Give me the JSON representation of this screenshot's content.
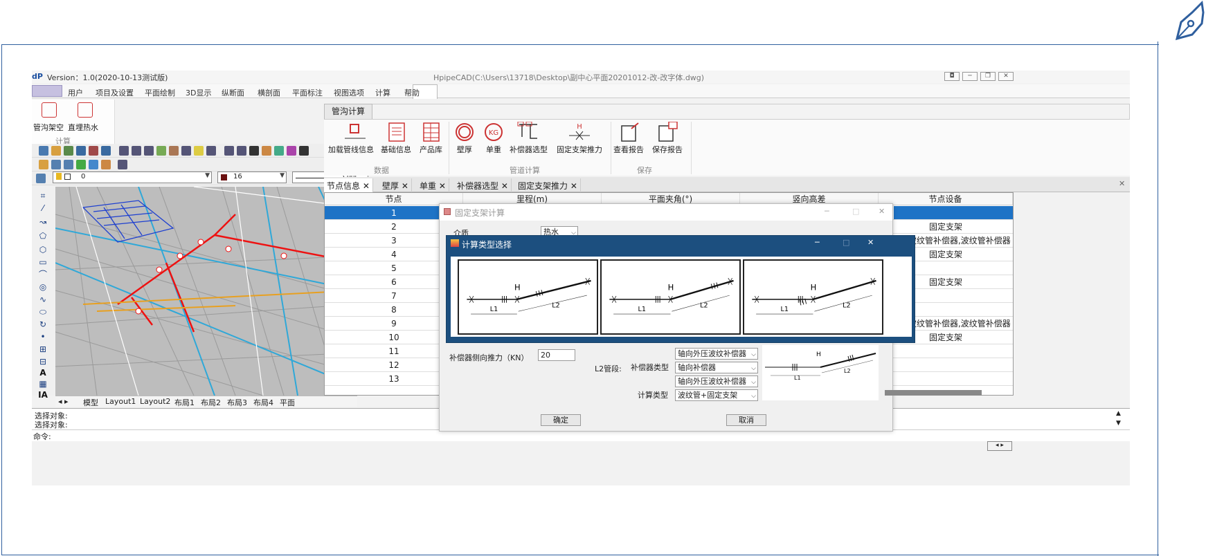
{
  "cad": {
    "version": "Version：1.0(2020-10-13测试版)",
    "title": "HpipeCAD(C:\\Users\\13718\\Desktop\\副中心平面20201012-改-改字体.dwg)",
    "menu": [
      "用户",
      "项目及设置",
      "平面绘制",
      "3D显示",
      "纵断面",
      "横剖面",
      "平面标注",
      "视图选项",
      "计算",
      "帮助"
    ],
    "left_ribbon": {
      "btn1": "管沟架空",
      "btn2": "直埋热水",
      "group": "计算"
    },
    "layer": "0",
    "color_value": "16",
    "linetype": "Cont",
    "layout_tabs": [
      "模型",
      "Layout1",
      "Layout2",
      "布局1",
      "布局2",
      "布局3",
      "布局4",
      "平面"
    ],
    "cmd_lines": [
      "选择对象:",
      "选择对象:",
      "命令:"
    ]
  },
  "ribbon": {
    "tab": "管沟计算",
    "buttons": [
      "加载管线信息",
      "基础信息",
      "产品库",
      "壁厚",
      "单重",
      "补偿器选型",
      "固定支架推力",
      "查看报告",
      "保存报告"
    ],
    "groups": [
      "数据",
      "管道计算",
      "保存"
    ]
  },
  "doc_tabs": [
    "节点信息",
    "壁厚",
    "单重",
    "补偿器选型",
    "固定支架推力"
  ],
  "table": {
    "headers": [
      "节点",
      "里程(m)",
      "平面夹角(°)",
      "竖向高差",
      "节点设备"
    ],
    "rows": [
      {
        "n": "1",
        "dev": ""
      },
      {
        "n": "2",
        "dev": "固定支架"
      },
      {
        "n": "3",
        "dev": "定支架,波纹管补偿器,波纹管补偿器"
      },
      {
        "n": "4",
        "dev": "固定支架"
      },
      {
        "n": "5",
        "dev": ""
      },
      {
        "n": "6",
        "dev": "固定支架"
      },
      {
        "n": "7",
        "dev": ""
      },
      {
        "n": "8",
        "dev": ""
      },
      {
        "n": "9",
        "dev": "定支架,波纹管补偿器,波纹管补偿器"
      },
      {
        "n": "10",
        "dev": "固定支架"
      },
      {
        "n": "11",
        "dev": ""
      },
      {
        "n": "12",
        "dev": ""
      },
      {
        "n": "13",
        "dev": ""
      }
    ]
  },
  "dialog1": {
    "title": "固定支架计算",
    "medium_label": "介质",
    "medium_value": "热水",
    "thrust_label": "补偿器侧向推力（KN）",
    "thrust_value": "20",
    "l2_label": "L2管段:",
    "comp_type_label": "补偿器类型",
    "calc_type_label": "计算类型",
    "dd1": "轴向外压波纹补偿器",
    "dd2": "轴向补偿器",
    "dd3": "轴向外压波纹补偿器",
    "dd4": "波纹管+固定支架",
    "ok": "确定",
    "cancel": "取消"
  },
  "dialog2": {
    "title": "计算类型选择",
    "schematic_labels": {
      "h": "H",
      "l1": "L1",
      "l2": "L2"
    }
  }
}
